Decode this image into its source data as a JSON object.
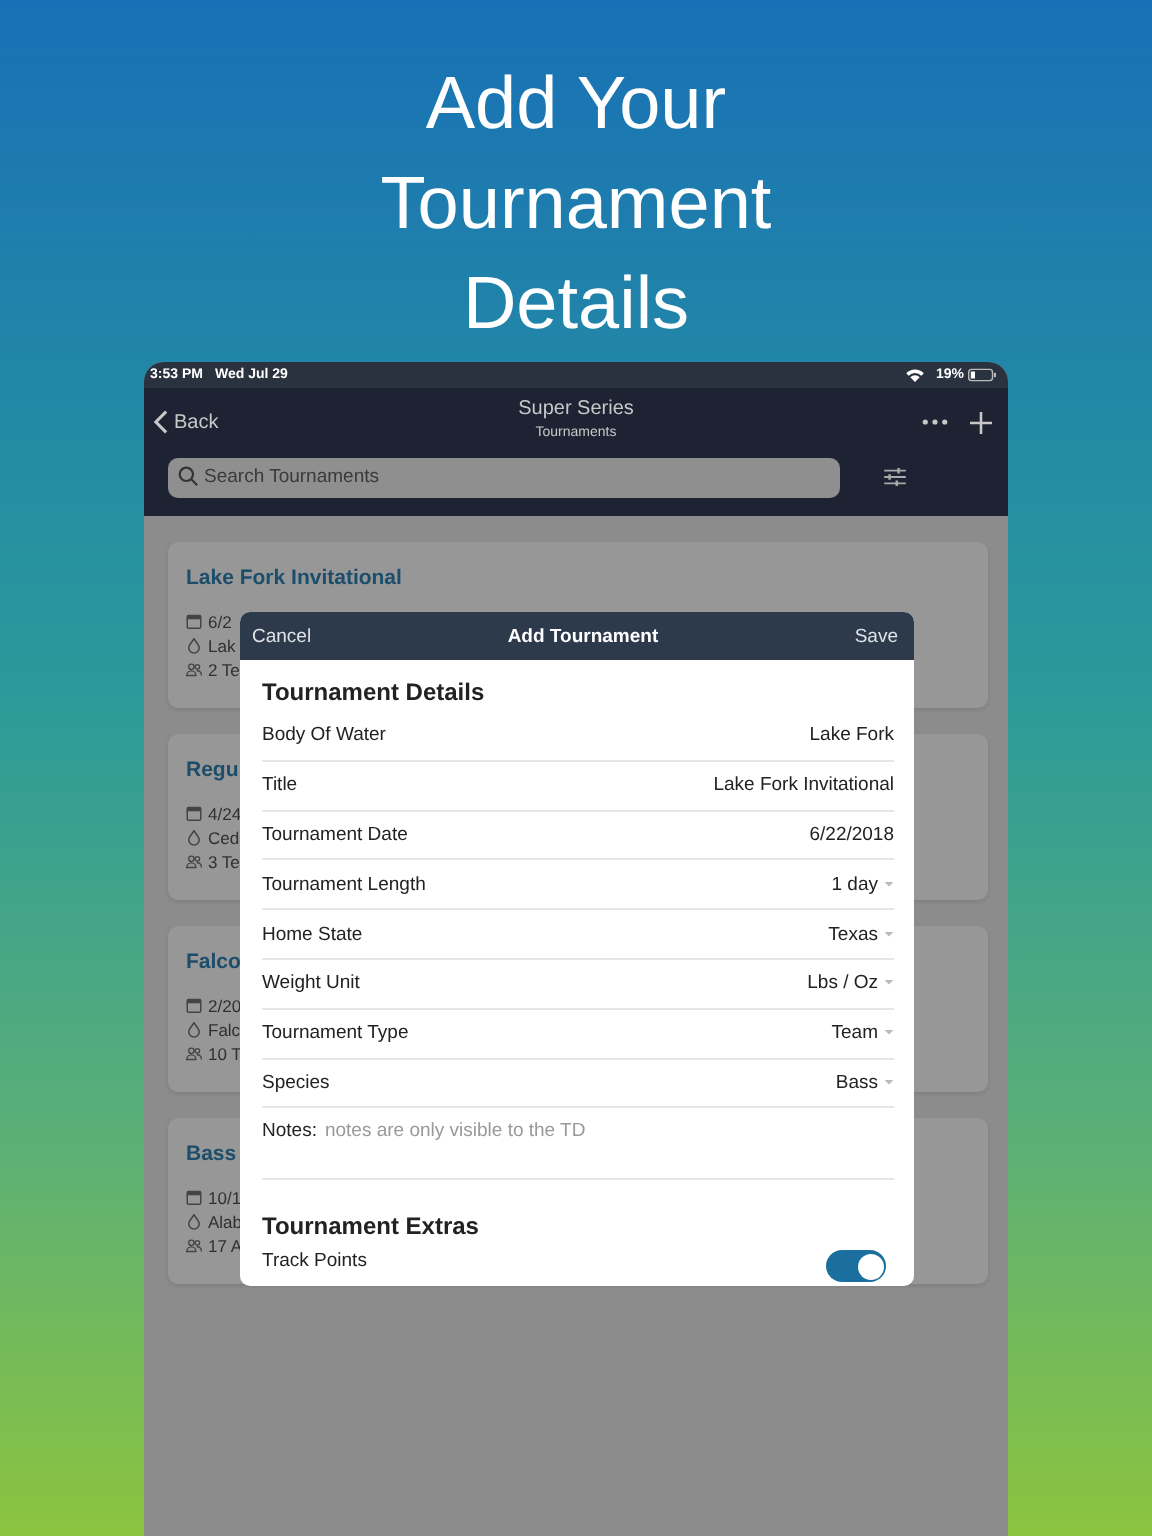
{
  "headline_lines": [
    "Add Your",
    "Tournament",
    "Details"
  ],
  "status_bar": {
    "time": "3:53 PM",
    "date": "Wed Jul 29",
    "battery": "19%"
  },
  "nav": {
    "back": "Back",
    "title": "Super Series",
    "subtitle": "Tournaments"
  },
  "search": {
    "placeholder": "Search Tournaments"
  },
  "cards": [
    {
      "title": "Lake Fork Invitational",
      "date": "6/2",
      "lake": "Lak",
      "teams": "2 Te"
    },
    {
      "title": "Regu",
      "date": "4/24",
      "lake": "Ced",
      "teams": "3 Te"
    },
    {
      "title": "Falco",
      "date": "2/20",
      "lake": "Falc",
      "teams": "10 T"
    },
    {
      "title": "Bass",
      "date": "10/1",
      "lake": "Alab",
      "teams": "17 A"
    }
  ],
  "modal": {
    "cancel": "Cancel",
    "title": "Add Tournament",
    "save": "Save",
    "sections": [
      {
        "heading": "Tournament Details",
        "rows": [
          {
            "kind": "value",
            "label": "Body Of Water",
            "value": "Lake Fork"
          },
          {
            "kind": "value",
            "label": "Title",
            "value": "Lake Fork Invitational"
          },
          {
            "kind": "value",
            "label": "Tournament Date",
            "value": "6/22/2018"
          },
          {
            "kind": "dropdown",
            "label": "Tournament Length",
            "value": "1 day"
          },
          {
            "kind": "dropdown",
            "label": "Home State",
            "value": "Texas"
          },
          {
            "kind": "dropdown",
            "label": "Weight Unit",
            "value": "Lbs / Oz"
          },
          {
            "kind": "dropdown",
            "label": "Tournament Type",
            "value": "Team"
          },
          {
            "kind": "dropdown",
            "label": "Species",
            "value": "Bass"
          },
          {
            "kind": "notes",
            "label": "Notes:",
            "placeholder": "notes are only visible to the TD"
          }
        ]
      },
      {
        "heading": "Tournament Extras",
        "rows": [
          {
            "kind": "toggle",
            "label": "Track Points",
            "on": true
          }
        ]
      }
    ]
  }
}
